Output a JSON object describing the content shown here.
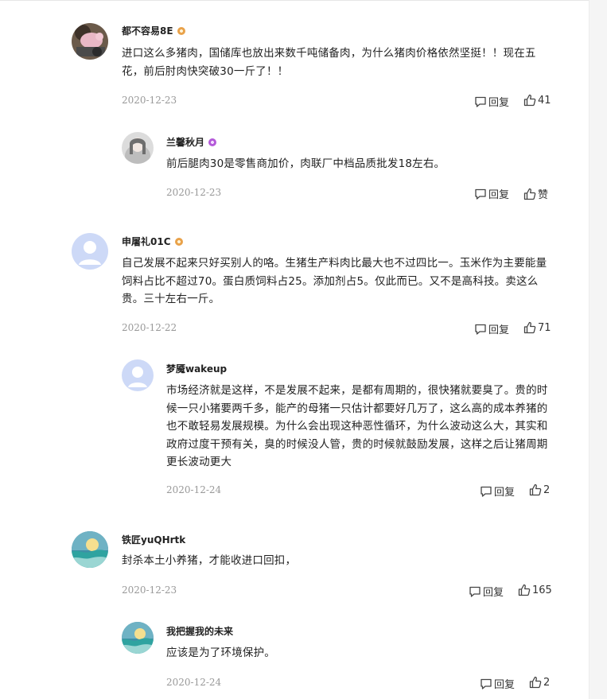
{
  "comments": [
    {
      "user": "都不容易8E",
      "text": "进口这么多猪肉，国储库也放出来数千吨储备肉，为什么猪肉价格依然坚挺！！现在五花，前后肘肉快突破30一斤了！！",
      "date": "2020-12-23",
      "reply_label": "回复",
      "likes": "41",
      "replies": [
        {
          "user": "兰馨秋月",
          "text": "前后腿肉30是零售商加价，肉联厂中档品质批发18左右。",
          "date": "2020-12-23",
          "reply_label": "回复",
          "likes": "赞"
        }
      ]
    },
    {
      "user": "申屠礼01C",
      "text": "自己发展不起来只好买别人的咯。生猪生产料肉比最大也不过四比一。玉米作为主要能量饲料占比不超过70。蛋白质饲料占25。添加剂占5。仅此而已。又不是高科技。卖这么贵。三十左右一斤。",
      "date": "2020-12-22",
      "reply_label": "回复",
      "likes": "71",
      "replies": [
        {
          "user": "梦魇wakeup",
          "text": "市场经济就是这样，不是发展不起来，是都有周期的，很快猪就要臭了。贵的时候一只小猪要两千多，能产的母猪一只估计都要好几万了，这么高的成本养猪的也不敢轻易发展规模。为什么会出现这种恶性循环，为什么波动这么大，其实和政府过度干预有关，臭的时候没人管，贵的时候就鼓励发展，这样之后让猪周期更长波动更大",
          "date": "2020-12-24",
          "reply_label": "回复",
          "likes": "2"
        }
      ]
    },
    {
      "user": "铁匠yuQHrtk",
      "text": "封杀本土小养猪，才能收进口回扣，",
      "date": "2020-12-23",
      "reply_label": "回复",
      "likes": "165",
      "replies": [
        {
          "user": "我把握我的未来",
          "text": "应该是为了环境保护。",
          "date": "2020-12-24",
          "reply_label": "回复",
          "likes": "2"
        }
      ]
    }
  ]
}
